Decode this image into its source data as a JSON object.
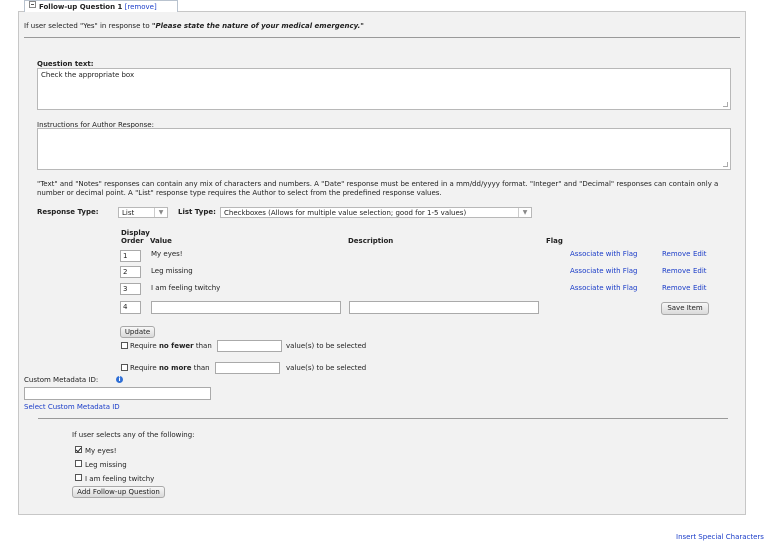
{
  "tab": {
    "title": "Follow-up Question 1",
    "remove_label": "[remove]"
  },
  "context": {
    "prefix": "If user selected \"Yes\" in response to ",
    "question": "\"Please state the nature of your medical emergency.\""
  },
  "question_text": {
    "label": "Question text:",
    "value": "Check the appropriate box"
  },
  "instructions": {
    "label": "Instructions for Author Response:",
    "value": ""
  },
  "help": {
    "line1": "\"Text\" and \"Notes\" responses can contain any mix of characters and numbers. A \"Date\" response must be entered in a mm/dd/yyyy format. \"Integer\" and \"Decimal\" responses can contain only a",
    "line2": "number or decimal point. A \"List\" response type requires the Author to select from the predefined response values."
  },
  "response": {
    "type_label": "Response Type:",
    "type_value": "List",
    "list_type_label": "List Type:",
    "list_type_value": "Checkboxes (Allows for multiple value selection; good for 1-5 values)"
  },
  "table": {
    "headers": {
      "display": "Display",
      "order": "Order",
      "value": "Value",
      "description": "Description",
      "flag": "Flag"
    },
    "rows": [
      {
        "order": "1",
        "value": "My eyes!",
        "flag_action": "Associate with Flag",
        "remove": "Remove",
        "edit": "Edit"
      },
      {
        "order": "2",
        "value": "Leg missing",
        "flag_action": "Associate with Flag",
        "remove": "Remove",
        "edit": "Edit"
      },
      {
        "order": "3",
        "value": "I am feeling twitchy",
        "flag_action": "Associate with Flag",
        "remove": "Remove",
        "edit": "Edit"
      }
    ],
    "new_row": {
      "order": "4",
      "save_label": "Save Item"
    }
  },
  "update_label": "Update",
  "require": {
    "fewer_prefix": "Require ",
    "fewer_bold": "no fewer",
    "fewer_suffix": " than",
    "more_prefix": "Require ",
    "more_bold": "no more",
    "more_suffix": " than",
    "tail": "value(s) to be selected"
  },
  "metadata": {
    "label": "Custom Metadata ID:",
    "select_link": "Select Custom Metadata ID"
  },
  "followup": {
    "label": "If user selects any of the following:",
    "options": [
      {
        "label": "My eyes!",
        "checked": true
      },
      {
        "label": "Leg missing",
        "checked": false
      },
      {
        "label": "I am feeling twitchy",
        "checked": false
      }
    ],
    "add_button": "Add Follow-up Question"
  },
  "footer_link": "Insert Special Characters"
}
